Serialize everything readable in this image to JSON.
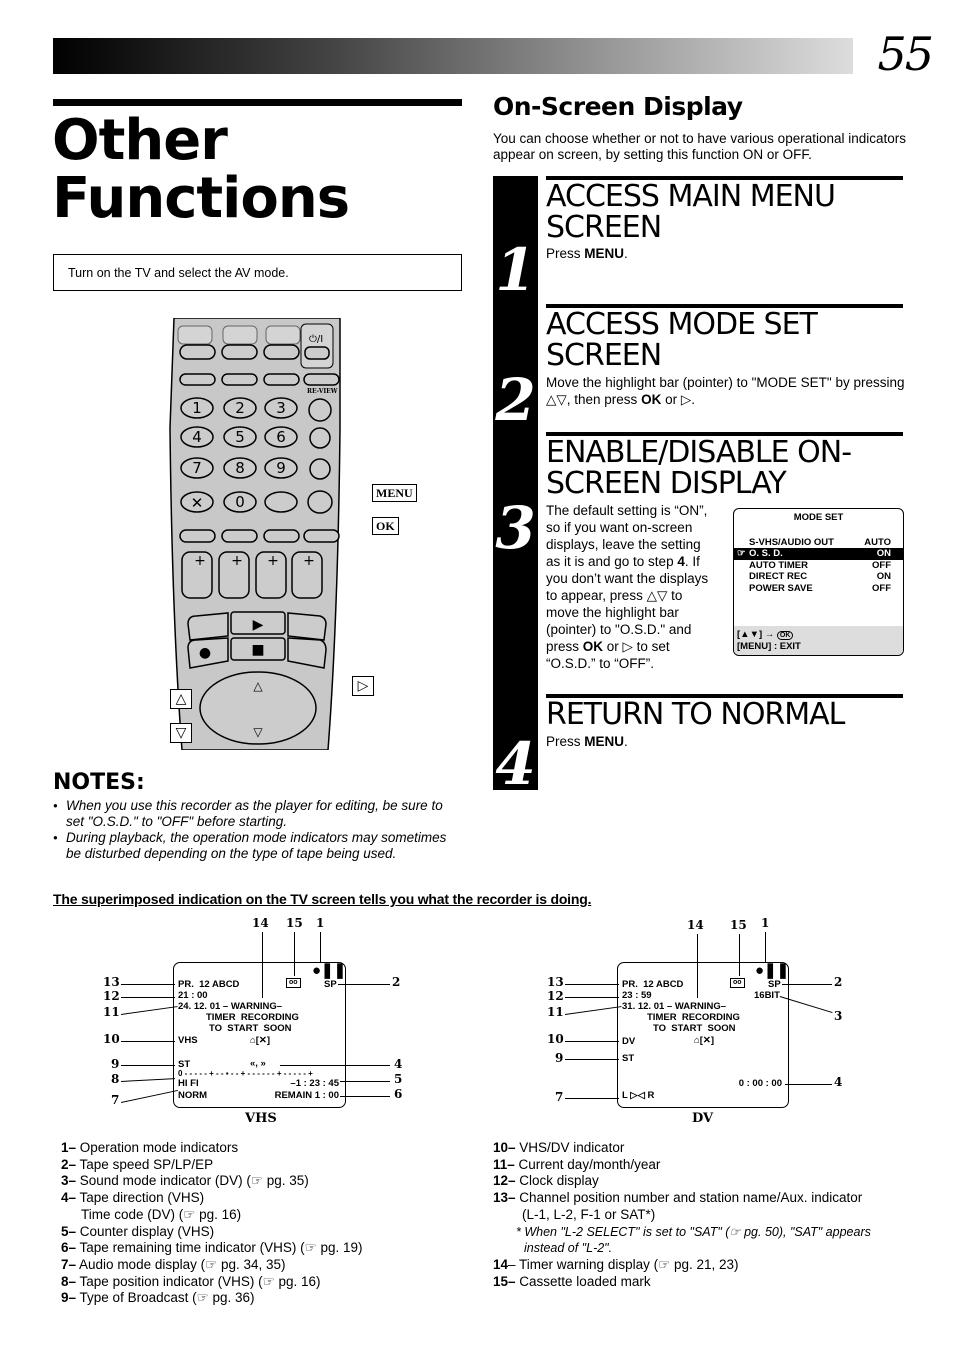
{
  "page": {
    "number": "55",
    "title_line1": "Other",
    "title_line2": "Functions",
    "instruction": "Turn on the TV and select the AV mode."
  },
  "remote": {
    "callouts": {
      "menu": "MENU",
      "ok": "OK"
    },
    "press_symbols": {
      "right": "▷",
      "up": "△",
      "down": "▽"
    },
    "keypad": [
      "1",
      "2",
      "3",
      "4",
      "5",
      "6",
      "7",
      "8",
      "9",
      "0"
    ],
    "labels": {
      "review": "RE-VIEW",
      "power": "⏻/I"
    }
  },
  "notes": {
    "title": "NOTES:",
    "items": [
      "When you use this recorder as the player for editing, be sure to set \"O.S.D.\" to \"OFF\" before starting.",
      "During playback, the operation mode indicators may sometimes be disturbed depending on the type of tape being used."
    ]
  },
  "section": {
    "title": "On-Screen Display",
    "intro": "You can choose whether or not to have various operational indicators appear on screen, by setting this function ON or OFF."
  },
  "steps": [
    {
      "number": "1",
      "title": "ACCESS MAIN MENU SCREEN",
      "text_pre": "Press ",
      "text_bold": "MENU",
      "text_post": "."
    },
    {
      "number": "2",
      "title": "ACCESS MODE SET SCREEN",
      "text": "Move the highlight bar (pointer) to \"MODE SET\" by pressing △▽, then press ",
      "text_bold": "OK",
      "text_post": " or ▷."
    },
    {
      "number": "3",
      "title": "ENABLE/DISABLE ON-SCREEN DISPLAY",
      "text_a": "The default setting is “ON”, so if you want on-screen displays, leave the setting as it is and go to step ",
      "text_b": "4",
      "text_c": ". If you don’t want the displays to appear, press △▽ to move the highlight bar (pointer) to \"O.S.D.\" and press ",
      "text_d": "OK",
      "text_e": " or ▷ to set “O.S.D.” to “OFF”."
    },
    {
      "number": "4",
      "title": "RETURN TO NORMAL",
      "text_pre": "Press ",
      "text_bold": "MENU",
      "text_post": "."
    }
  ],
  "mode_set_screen": {
    "title": "MODE SET",
    "rows": [
      {
        "label": "S-VHS/AUDIO OUT",
        "value": "AUTO",
        "selected": false
      },
      {
        "label": "O. S. D.",
        "value": "ON",
        "selected": true
      },
      {
        "label": "AUTO TIMER",
        "value": "OFF",
        "selected": false
      },
      {
        "label": "DIRECT REC",
        "value": "ON",
        "selected": false
      },
      {
        "label": "POWER SAVE",
        "value": "OFF",
        "selected": false
      }
    ],
    "footer_line1": "[▲▼] →",
    "footer_ok_icon": "OK",
    "footer_line2": "[MENU] : EXIT"
  },
  "osd_heading": "The superimposed indication on the TV screen tells you what the recorder is doing.",
  "osd_vhs": {
    "caption": "VHS",
    "channel": "PR.  12 ABCD",
    "speed": "SP",
    "clock": "21 : 00",
    "date_warning": "24. 12. 01 – WARNING–",
    "warning2": "TIMER  RECORDING",
    "warning3": "TO  START  SOON",
    "mode": "VHS",
    "timer_icon": "[✕]",
    "broadcast": "ST",
    "direction": "«, »",
    "tape_position": "0 - - - - - + - - ▪ - - + - - - - - - + - - - - - +",
    "audio": "HI FI",
    "counter": "–1 : 23 : 45",
    "norm": "NORM",
    "remain": "REMAIN 1 : 00",
    "callouts_left": [
      "13",
      "12",
      "11",
      "10",
      "9",
      "8",
      "7"
    ],
    "callouts_right": [
      "2",
      "4",
      "5",
      "6"
    ],
    "callouts_top": [
      "14",
      "15",
      "1"
    ]
  },
  "osd_dv": {
    "caption": "DV",
    "channel": "PR.  12 ABCD",
    "speed": "SP",
    "sound": "16BIT",
    "clock": "23 : 59",
    "date_warning": "31. 12. 01 – WARNING–",
    "warning2": "TIMER  RECORDING",
    "warning3": "TO  START  SOON",
    "mode": "DV",
    "timer_icon": "[✕]",
    "broadcast": "ST",
    "timecode": "0 : 00 : 00",
    "audio": "L ▷◁ R",
    "callouts_left": [
      "13",
      "12",
      "11",
      "10",
      "9",
      "7"
    ],
    "callouts_right": [
      "2",
      "3",
      "4"
    ],
    "callouts_top": [
      "14",
      "15",
      "1"
    ]
  },
  "legend_left": [
    {
      "num": "1–",
      "text": " Operation mode indicators"
    },
    {
      "num": "2–",
      "text": " Tape speed SP/LP/EP"
    },
    {
      "num": "3–",
      "text": " Sound mode indicator (DV) (☞ pg. 35)"
    },
    {
      "num": "4–",
      "text": " Tape direction (VHS)"
    },
    {
      "num": "",
      "text": "Time code (DV) (☞ pg. 16)"
    },
    {
      "num": "5–",
      "text": " Counter display (VHS)"
    },
    {
      "num": "6–",
      "text": " Tape remaining time indicator (VHS) (☞ pg. 19)"
    },
    {
      "num": "7–",
      "text": " Audio mode display (☞ pg. 34, 35)"
    },
    {
      "num": "8–",
      "text": " Tape position indicator (VHS) (☞ pg. 16)"
    },
    {
      "num": "9–",
      "text": " Type of Broadcast (☞ pg. 36)"
    }
  ],
  "legend_right": [
    {
      "num": "10–",
      "text": " VHS/DV indicator"
    },
    {
      "num": "11–",
      "text": " Current day/month/year"
    },
    {
      "num": "12–",
      "text": " Clock display"
    },
    {
      "num": "13–",
      "text": " Channel position number and station name/Aux. indicator"
    },
    {
      "num": "",
      "text": "(L-1, L-2, F-1 or SAT*)"
    },
    {
      "num": "",
      "text": "* When \"L-2 SELECT\" is set to \"SAT\" (☞ pg. 50), \"SAT\" appears instead of \"L-2\".",
      "note": true
    },
    {
      "num": "14",
      "text": "– Timer warning display (☞ pg. 21, 23)"
    },
    {
      "num": "15–",
      "text": " Cassette loaded mark"
    }
  ]
}
